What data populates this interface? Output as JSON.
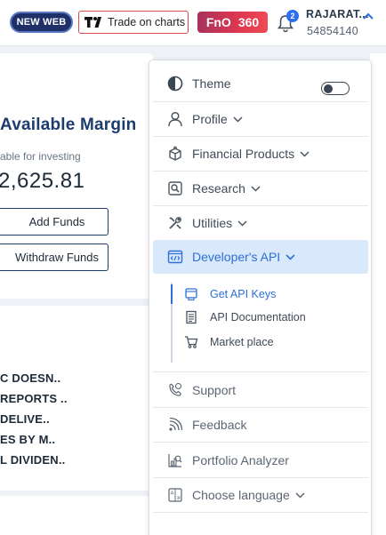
{
  "header": {
    "new_web_label": "NEW WEB",
    "trade_on_charts_label": "Trade on charts",
    "fno_label": "FnO",
    "fno_count": "360",
    "notification_count": "2",
    "user_name": "RAJARAT...",
    "user_id": "54854140"
  },
  "margin_card": {
    "title": "Available Margin",
    "subtitle": "able for investing",
    "amount": "2,625.81",
    "add_funds_label": "Add Funds",
    "withdraw_funds_label": "Withdraw Funds"
  },
  "news": {
    "items": [
      "C DOESN..",
      "REPORTS ..",
      " DELIVE..",
      "ES BY M..",
      "L DIVIDEN.."
    ]
  },
  "menu": {
    "theme_label": "Theme",
    "items": [
      {
        "label": "Profile",
        "icon": "user-icon"
      },
      {
        "label": "Financial Products",
        "icon": "box-icon"
      },
      {
        "label": "Research",
        "icon": "research-icon"
      },
      {
        "label": "Utilities",
        "icon": "tools-icon"
      },
      {
        "label": "Developer's API",
        "icon": "api-icon"
      }
    ],
    "developer_api_subitems": [
      {
        "label": "Get API Keys",
        "icon": "key-screen-icon"
      },
      {
        "label": "API Documentation",
        "icon": "document-icon"
      },
      {
        "label": "Market place",
        "icon": "cart-icon"
      }
    ],
    "bottom_items": [
      {
        "label": "Support",
        "icon": "support-icon"
      },
      {
        "label": "Feedback",
        "icon": "feedback-icon"
      },
      {
        "label": "Portfolio Analyzer",
        "icon": "analyzer-icon"
      },
      {
        "label": "Choose language",
        "icon": "language-icon"
      }
    ]
  },
  "colors": {
    "brand_navy": "#1f2f68",
    "active_blue": "#2e6fd8",
    "active_bg": "#d9e8fb",
    "fno_red": "#e0374f"
  }
}
